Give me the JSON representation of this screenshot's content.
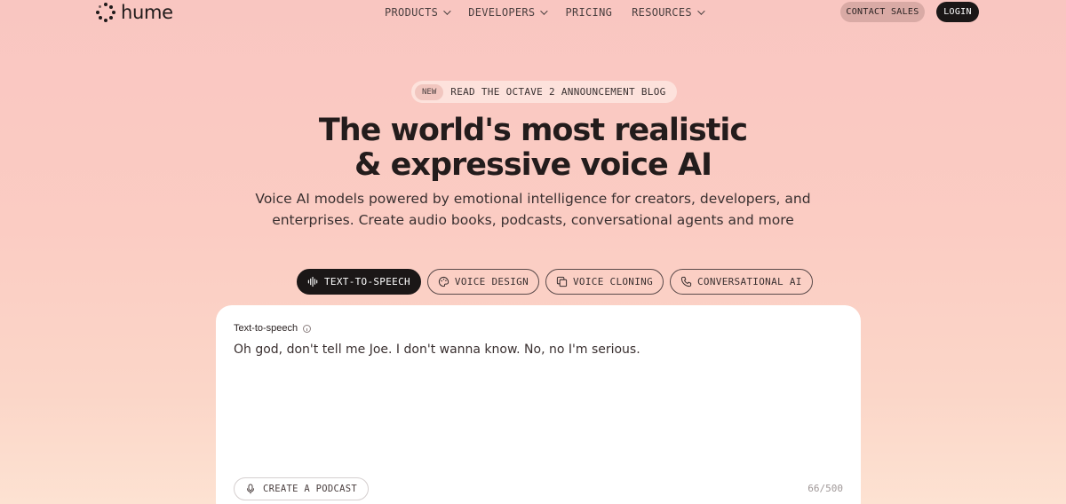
{
  "brand": {
    "name": "hume"
  },
  "nav": {
    "items": [
      {
        "label": "PRODUCTS",
        "has_dropdown": true
      },
      {
        "label": "DEVELOPERS",
        "has_dropdown": true
      },
      {
        "label": "PRICING",
        "has_dropdown": false
      },
      {
        "label": "RESOURCES",
        "has_dropdown": true
      }
    ],
    "contact_label": "CONTACT SALES",
    "login_label": "LOGIN"
  },
  "announcement": {
    "badge": "NEW",
    "text": "READ THE OCTAVE 2 ANNOUNCEMENT BLOG"
  },
  "hero": {
    "title_line1": "The world's most realistic",
    "title_line2": "& expressive voice AI",
    "subtitle_line1": "Voice AI models powered by emotional intelligence for creators, developers, and",
    "subtitle_line2": "enterprises. Create audio books, podcasts, conversational agents and more"
  },
  "tabs": [
    {
      "label": "TEXT-TO-SPEECH",
      "icon": "waveform-icon",
      "active": true
    },
    {
      "label": "VOICE DESIGN",
      "icon": "palette-icon",
      "active": false
    },
    {
      "label": "VOICE CLONING",
      "icon": "copy-icon",
      "active": false
    },
    {
      "label": "CONVERSATIONAL AI",
      "icon": "phone-icon",
      "active": false
    }
  ],
  "card": {
    "label": "Text-to-speech",
    "text": "Oh god, don't tell me Joe. I don't wanna know. No, no I'm serious.",
    "podcast_label": "CREATE A PODCAST",
    "counter": "66/500"
  },
  "colors": {
    "background_top": "#f9c6c1",
    "background_bottom": "#fde2d2",
    "dark": "#1b1717",
    "contact_bg": "#d9aaa5"
  }
}
